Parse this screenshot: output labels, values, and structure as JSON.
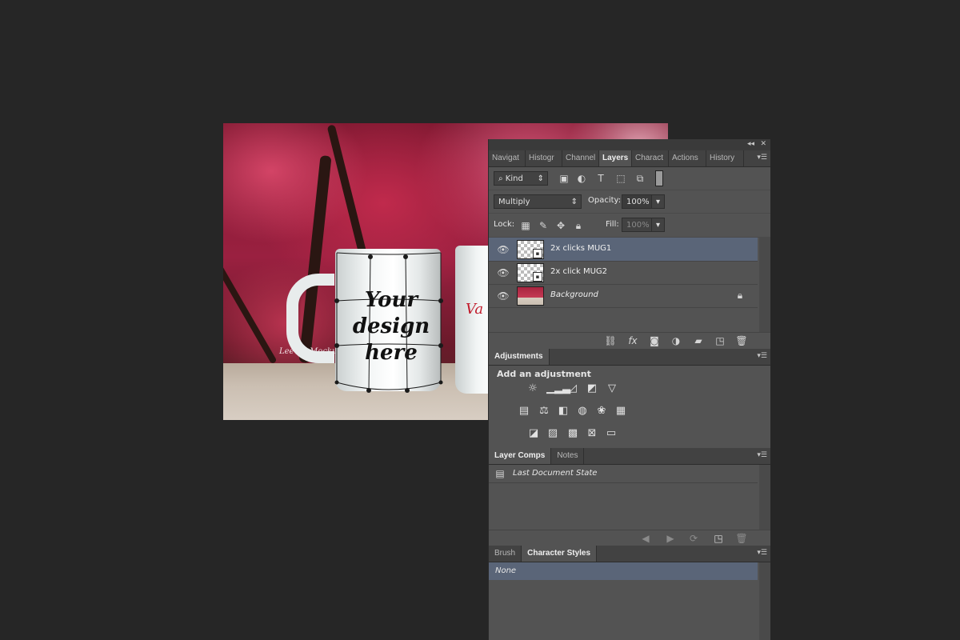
{
  "canvas": {
    "mug1_text": [
      "Your",
      "design",
      "here"
    ],
    "mug2_text": "Va",
    "watermark": "Lee Ko Mockups"
  },
  "panel_dock": {
    "collapse_icon": "double-chevron-left-icon",
    "close_icon": "close-icon",
    "tabs": [
      "Navigat",
      "Histogr",
      "Channel",
      "Layers",
      "Charact",
      "Actions",
      "History"
    ],
    "active_tab": "Layers",
    "filter": {
      "label": "Kind"
    },
    "blend_mode": "Multiply",
    "opacity_label": "Opacity:",
    "opacity_value": "100%",
    "lock_label": "Lock:",
    "fill_label": "Fill:",
    "fill_value": "100%",
    "layers": [
      {
        "name": "2x clicks MUG1",
        "selected": true,
        "italic": false,
        "type": "smart-object"
      },
      {
        "name": "2x click MUG2",
        "selected": false,
        "italic": false,
        "type": "smart-object"
      },
      {
        "name": "Background",
        "selected": false,
        "italic": true,
        "locked": true
      }
    ]
  },
  "adjustments": {
    "tab": "Adjustments",
    "heading": "Add an adjustment"
  },
  "layer_comps": {
    "tabs": [
      "Layer Comps",
      "Notes"
    ],
    "active_tab": "Layer Comps",
    "items": [
      "Last Document State"
    ]
  },
  "char_styles": {
    "tabs": [
      "Brush",
      "Character Styles"
    ],
    "active_tab": "Character Styles",
    "items": [
      "None"
    ]
  },
  "colors": {
    "app_bg": "#262626",
    "panel_bg": "#535353",
    "selected_row": "#5a6578"
  }
}
